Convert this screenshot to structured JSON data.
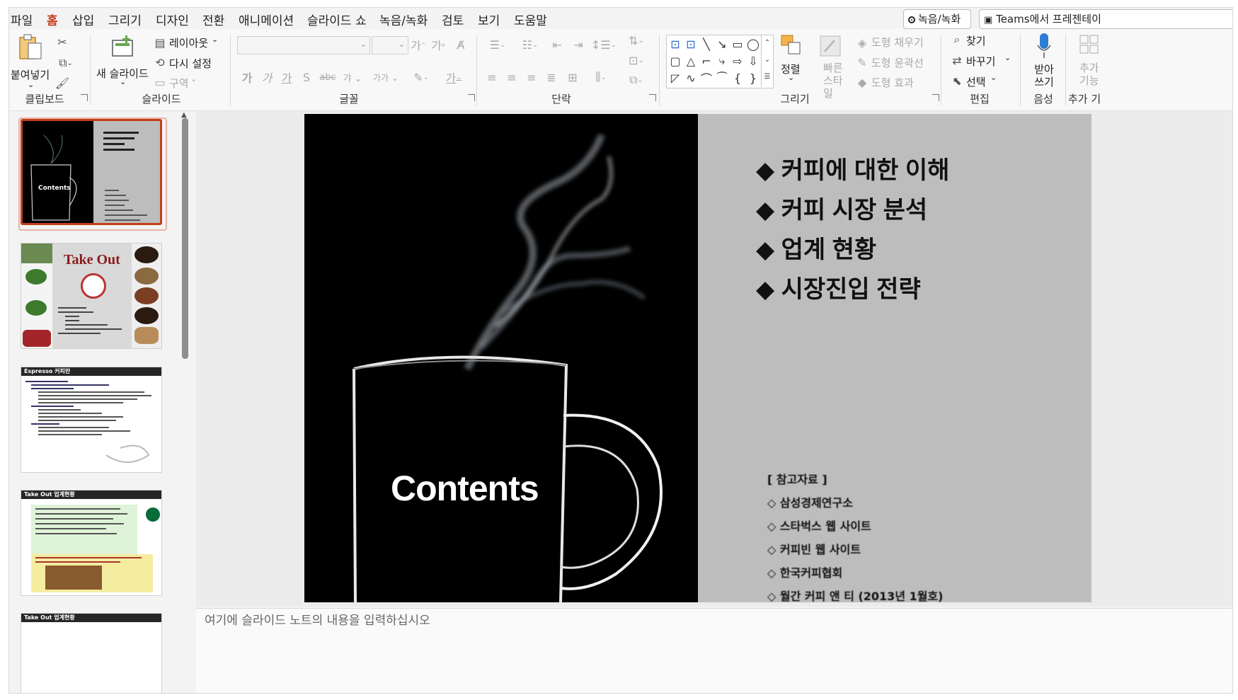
{
  "menu": {
    "items": [
      "파일",
      "홈",
      "삽입",
      "그리기",
      "디자인",
      "전환",
      "애니메이션",
      "슬라이드 쇼",
      "녹음/녹화",
      "검토",
      "보기",
      "도움말"
    ],
    "active_index": 1,
    "record_button": "녹음/녹화",
    "teams_button": "Teams에서 프레젠테이"
  },
  "ribbon": {
    "clipboard": {
      "paste_label": "붙여넣기",
      "group_label": "클립보드"
    },
    "slides": {
      "new_slide_label": "새 슬라이드",
      "layout_label": "레이아웃",
      "reset_label": "다시 설정",
      "section_label": "구역",
      "group_label": "슬라이드"
    },
    "font": {
      "group_label": "글꼴",
      "font_name": "",
      "font_size": ""
    },
    "paragraph": {
      "group_label": "단락"
    },
    "drawing": {
      "arrange_label": "정렬",
      "quick_styles_label": "빠른 스타일",
      "fill_label": "도형 채우기",
      "outline_label": "도형 윤곽선",
      "effects_label": "도형 효과",
      "group_label": "그리기"
    },
    "editing": {
      "find_label": "찾기",
      "replace_label": "바꾸기",
      "select_label": "선택",
      "group_label": "편집"
    },
    "voice": {
      "dictate_label": "받아 쓰기",
      "group_label": "음성"
    },
    "addins": {
      "label": "추가 기능",
      "group_label": "추가 기"
    }
  },
  "thumbnails": [
    {
      "index": 1,
      "selected": true
    },
    {
      "index": 2,
      "title": "Take Out",
      "selected": false
    },
    {
      "index": 3,
      "header": "Espresso 커피란",
      "selected": false
    },
    {
      "index": 4,
      "header": "Take Out 업계현황",
      "selected": false
    },
    {
      "index": 5,
      "header": "Take Out 업계현황",
      "selected": false
    }
  ],
  "slide": {
    "title": "Contents",
    "agenda": [
      "◆ 커피에 대한 이해",
      "◆ 커피 시장 분석",
      "◆ 업계 현황",
      "◆ 시장진입 전략"
    ],
    "references_header": "[ 참고자료 ]",
    "references": [
      "◇ 삼성경제연구소",
      "◇ 스타벅스 웹 사이트",
      "◇ 커피빈 웹 사이트",
      "◇ 한국커피협회",
      "◇ 월간 커피 앤 티 (2013년 1월호)"
    ]
  },
  "notes": {
    "placeholder": "여기에 슬라이드 노트의 내용을 입력하십시오"
  },
  "colors": {
    "accent": "#c43e1c",
    "slide_right_bg": "#bdbdbd",
    "slide_left_bg": "#000000"
  }
}
